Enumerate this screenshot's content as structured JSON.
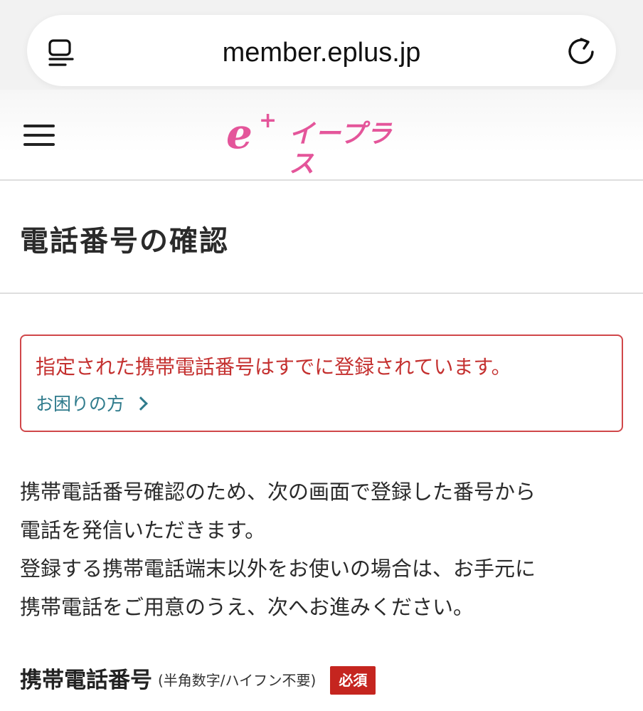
{
  "browser": {
    "url": "member.eplus.jp",
    "reader_icon": "reader-mode-icon",
    "reload_icon": "reload-icon"
  },
  "header": {
    "menu_icon": "hamburger-menu-icon",
    "logo_mark": "e",
    "logo_plus": "+",
    "logo_text": "イープラス",
    "brand_color": "#e4559a"
  },
  "page": {
    "title": "電話番号の確認"
  },
  "alert": {
    "message": "指定された携帯電話番号はすでに登録されています。",
    "help_link": "お困りの方",
    "error_color": "#c4302f",
    "link_color": "#2f7b8c"
  },
  "description": {
    "lines": [
      "携帯電話番号確認のため、次の画面で登録した番号から",
      "電話を発信いただきます。",
      "登録する携帯電話端末以外をお使いの場合は、お手元に",
      "携帯電話をご用意のうえ、次へお進みください。"
    ]
  },
  "form": {
    "phone_label": "携帯電話番号",
    "phone_hint": "(半角数字/ハイフン不要)",
    "required_badge": "必須",
    "badge_color": "#c5251f"
  }
}
